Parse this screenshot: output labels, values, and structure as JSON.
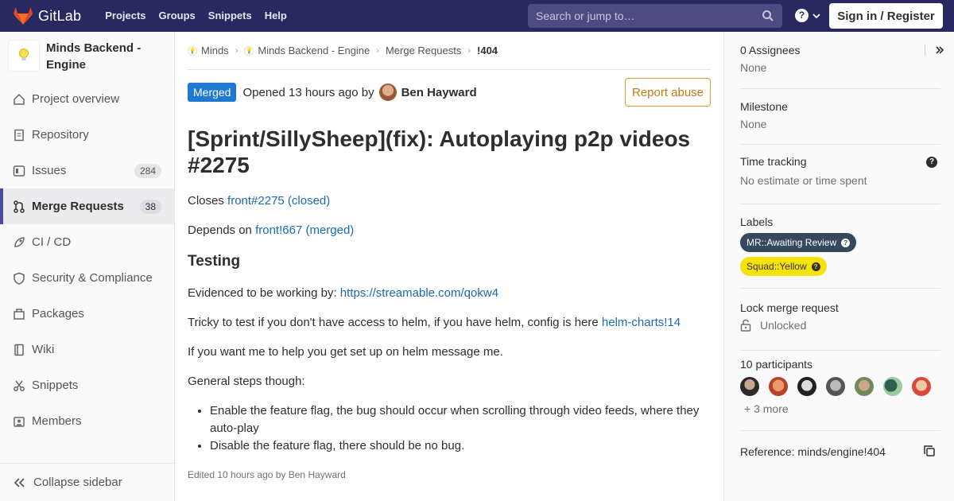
{
  "navbar": {
    "brand": "GitLab",
    "links": [
      "Projects",
      "Groups",
      "Snippets",
      "Help"
    ],
    "search_placeholder": "Search or jump to…",
    "help_glyph": "?",
    "signin_label": "Sign in / Register",
    "bg_color": "#292961"
  },
  "sidebar": {
    "project_name": "Minds Backend - Engine",
    "items": [
      {
        "label": "Project overview",
        "icon": "home-icon"
      },
      {
        "label": "Repository",
        "icon": "doc-icon"
      },
      {
        "label": "Issues",
        "icon": "issues-icon",
        "count": "284"
      },
      {
        "label": "Merge Requests",
        "icon": "merge-request-icon",
        "count": "38",
        "active": true
      },
      {
        "label": "CI / CD",
        "icon": "rocket-icon"
      },
      {
        "label": "Security & Compliance",
        "icon": "shield-icon"
      },
      {
        "label": "Packages",
        "icon": "package-icon"
      },
      {
        "label": "Wiki",
        "icon": "book-icon"
      },
      {
        "label": "Snippets",
        "icon": "scissors-icon"
      },
      {
        "label": "Members",
        "icon": "users-icon"
      }
    ],
    "collapse_label": "Collapse sidebar"
  },
  "breadcrumb": {
    "items": [
      "Minds",
      "Minds Backend - Engine",
      "Merge Requests",
      "!404"
    ]
  },
  "mr": {
    "status": "Merged",
    "opened_text": "Opened 13 hours ago by",
    "author": "Ben Hayward",
    "report_label": "Report abuse",
    "title": "[Sprint/SillySheep](fix): Autoplaying p2p videos #2275",
    "closes_prefix": "Closes ",
    "closes_link": "front#2275 (closed)",
    "depends_prefix": "Depends on ",
    "depends_link": "front!667 (merged)",
    "testing_heading": "Testing",
    "evidence_prefix": "Evidenced to be working by: ",
    "evidence_link": "https://streamable.com/qokw4",
    "tricky_text": "Tricky to test if you don't have access to helm, if you have helm, config is here ",
    "tricky_link": "helm-charts!14",
    "help_text": "If you want me to help you get set up on helm message me.",
    "general_steps": "General steps though:",
    "steps": [
      "Enable the feature flag, the bug should occur when scrolling through video feeds, where they auto-play",
      "Disable the feature flag, there should be no bug."
    ],
    "edited": "Edited 10 hours ago by Ben Hayward"
  },
  "right_sidebar": {
    "assignees_label": "0 Assignees",
    "assignees_value": "None",
    "milestone_label": "Milestone",
    "milestone_value": "None",
    "time_label": "Time tracking",
    "time_value": "No estimate or time spent",
    "labels_label": "Labels",
    "labels": [
      "MR::Awaiting Review",
      "Squad::Yellow"
    ],
    "lock_label": "Lock merge request",
    "lock_value": "Unlocked",
    "participants_label": "10 participants",
    "participants_more": "+ 3 more",
    "reference": "Reference: minds/engine!404"
  }
}
